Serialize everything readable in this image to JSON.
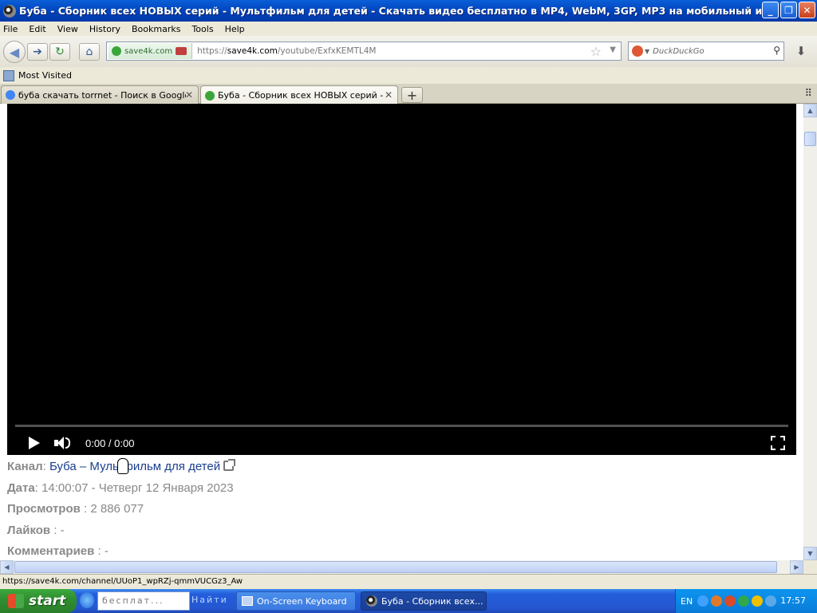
{
  "window": {
    "title": "Буба - Сборник всех НОВЫХ серий - Мультфильм для детей - Скачать видео бесплатно в MP4, WebM, 3GP, MP3 на мобильный или ПК - Mypal",
    "controls": {
      "minimize": "_",
      "maximize": "❐",
      "close": "✕"
    }
  },
  "menu": [
    "File",
    "Edit",
    "View",
    "History",
    "Bookmarks",
    "Tools",
    "Help"
  ],
  "nav": {
    "back_icon": "arrow-left-icon",
    "forward_icon": "arrow-right-icon",
    "reload_icon": "reload-icon",
    "home_icon": "home-icon"
  },
  "url_bar": {
    "site_identity": "save4k.com",
    "url_prefix": "https://",
    "url_domain": "save4k.com",
    "url_path": "/youtube/ExfxKEMTL4M"
  },
  "search_bar": {
    "placeholder": "DuckDuckGo"
  },
  "bookmarks_bar": {
    "most_visited": "Most Visited"
  },
  "tabs": [
    {
      "label": "буба скачать torrnet - Поиск в Google",
      "favicon_color": "#4285f4",
      "active": false
    },
    {
      "label": "Буба - Сборник всех НОВЫХ серий - Му...",
      "favicon_color": "#3aa53a",
      "active": true
    }
  ],
  "player": {
    "time": "0:00 / 0:00",
    "progress": 0
  },
  "video_info": {
    "channel_label": "Канал",
    "channel_name": "Буба – Мультфильм для детей",
    "date_label": "Дата",
    "date_value": "14:00:07 - Четверг 12 Января 2023",
    "views_label": "Просмотров",
    "views_value": "2 886 077",
    "likes_label": "Лайков",
    "likes_value": "-",
    "comments_label": "Комментариев",
    "comments_value": "-"
  },
  "status_bar": {
    "text": "https://save4k.com/channel/UUoP1_wpRZj-qmmVUCGz3_Aw"
  },
  "taskbar": {
    "start": "start",
    "search_text": "бесплат...",
    "find_text": "Найти",
    "tasks": [
      {
        "label": "On-Screen Keyboard"
      },
      {
        "label": "Буба - Сборник всех..."
      }
    ],
    "language": "EN",
    "clock": "17:57"
  }
}
